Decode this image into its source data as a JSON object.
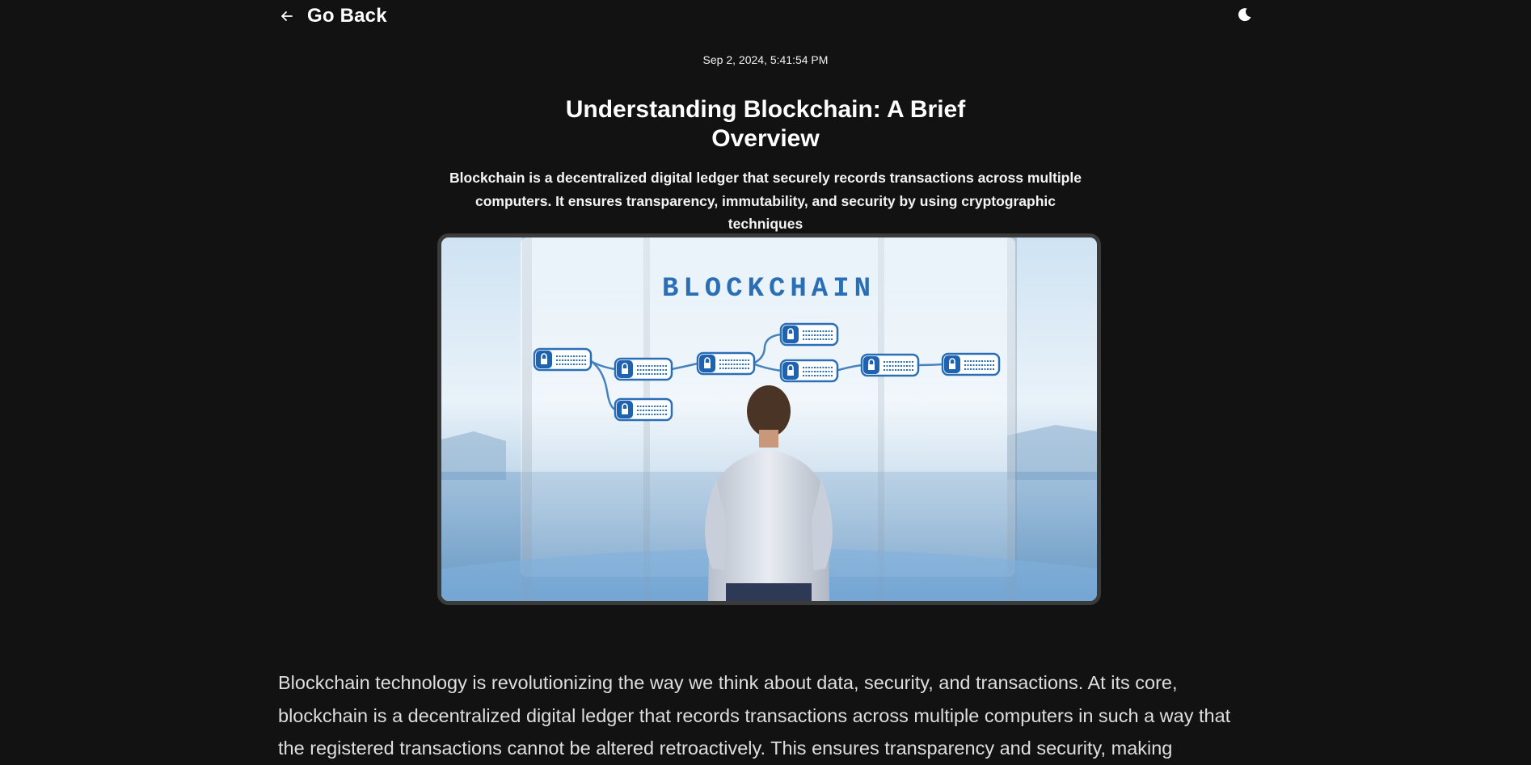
{
  "header": {
    "back_label": "Go Back",
    "back_icon": "arrow-left-icon",
    "theme_icon": "moon-icon"
  },
  "article": {
    "timestamp": "Sep 2, 2024, 5:41:54 PM",
    "title": "Understanding Blockchain: A Brief Overview",
    "subtitle": "Blockchain is a decentralized digital ledger that securely records transactions across multiple computers. It ensures transparency, immutability, and security by using cryptographic techniques",
    "image": {
      "caption_text": "BLOCKCHAIN"
    },
    "body": "Blockchain technology is revolutionizing the way we think about data, security, and transactions. At its core, blockchain is a decentralized digital ledger that records transactions across multiple computers in such a way that the registered transactions cannot be altered retroactively. This ensures transparency and security, making"
  },
  "colors": {
    "background": "#121212",
    "text": "#ffffff",
    "body_text": "#dedede",
    "image_border": "#3b3b3b",
    "block_blue": "#1f63b0"
  }
}
